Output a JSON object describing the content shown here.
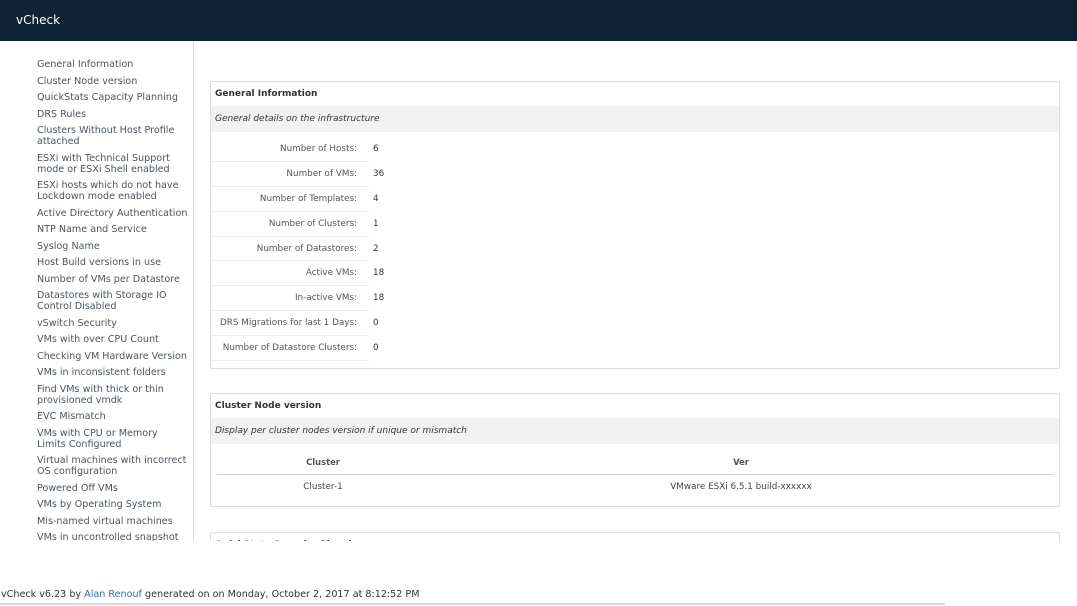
{
  "app": {
    "title": "vCheck"
  },
  "sidebar": {
    "items": [
      "General Information",
      "Cluster Node version",
      "QuickStats Capacity Planning",
      "DRS Rules",
      "Clusters Without Host Profile attached",
      "ESXi with Technical Support mode or ESXi Shell enabled",
      "ESXi hosts which do not have Lockdown mode enabled",
      "Active Directory Authentication",
      "NTP Name and Service",
      "Syslog Name",
      "Host Build versions in use",
      "Number of VMs per Datastore",
      "Datastores with Storage IO Control Disabled",
      "vSwitch Security",
      "VMs with over CPU Count",
      "Checking VM Hardware Version",
      "VMs in inconsistent folders",
      "Find VMs with thick or thin provisioned vmdk",
      "EVC Mismatch",
      "VMs with CPU or Memory Limits Configured",
      "Virtual machines with incorrect OS configuration",
      "Powered Off VMs",
      "VMs by Operating System",
      "Mis-named virtual machines",
      "VMs in uncontrolled snapshot"
    ]
  },
  "general_info": {
    "title": "General Information",
    "description": "General details on the infrastructure",
    "rows": [
      {
        "label": "Number of Hosts:",
        "value": "6"
      },
      {
        "label": "Number of VMs:",
        "value": "36"
      },
      {
        "label": "Number of Templates:",
        "value": "4"
      },
      {
        "label": "Number of Clusters:",
        "value": "1"
      },
      {
        "label": "Number of Datastores:",
        "value": "2"
      },
      {
        "label": "Active VMs:",
        "value": "18"
      },
      {
        "label": "In-active VMs:",
        "value": "18"
      },
      {
        "label": "DRS Migrations for last 1 Days:",
        "value": "0"
      },
      {
        "label": "Number of Datastore Clusters:",
        "value": "0"
      }
    ]
  },
  "cluster_node": {
    "title": "Cluster Node version",
    "description": "Display per cluster nodes version if unique or mismatch",
    "columns": [
      "Cluster",
      "Ver"
    ],
    "rows": [
      [
        "Cluster-1",
        "VMware ESXi 6.5.1 build-xxxxxx"
      ]
    ]
  },
  "quickstats": {
    "title": "QuickStats Capacity Planning"
  },
  "footer": {
    "prefix": "vCheck v6.23 by ",
    "author": "Alan Renouf",
    "suffix": " generated on on Monday, October 2, 2017 at 8:12:52 PM"
  }
}
